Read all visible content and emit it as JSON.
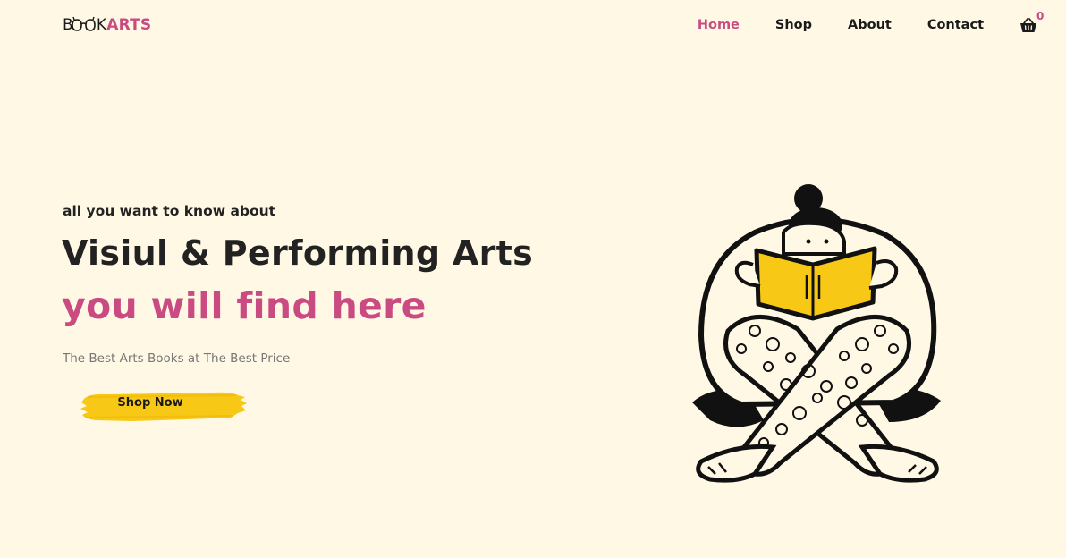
{
  "brand": {
    "prefix": "B",
    "middle": "K",
    "suffix": "ARTS",
    "accent": "#c94b82"
  },
  "nav": {
    "items": [
      {
        "label": "Home",
        "active": true
      },
      {
        "label": "Shop",
        "active": false
      },
      {
        "label": "About",
        "active": false
      },
      {
        "label": "Contact",
        "active": false
      }
    ],
    "cart_icon": "basket-icon",
    "cart_count": "0"
  },
  "hero": {
    "eyebrow": "all you want to know about",
    "title": "Visiul & Performing Arts",
    "title_accent": "you will find here",
    "subtitle": "The Best Arts Books at The Best Price",
    "cta_label": "Shop Now",
    "cta_color": "#f7c815",
    "illustration": "person-reading-book-illustration"
  },
  "colors": {
    "background": "#fff8e4",
    "accent": "#c94b82",
    "button": "#f7c815"
  }
}
